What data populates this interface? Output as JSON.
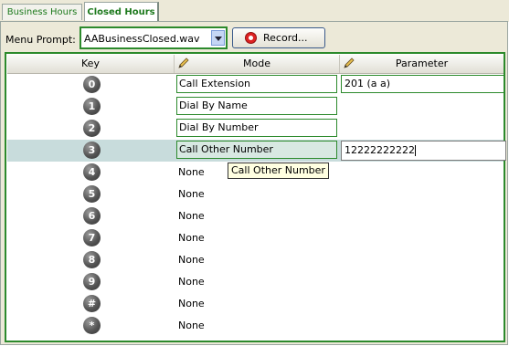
{
  "tabs": [
    {
      "label": "Business Hours"
    },
    {
      "label": "Closed Hours"
    }
  ],
  "prompt": {
    "label": "Menu Prompt:",
    "selected": "AABusinessClosed.wav",
    "record_label": "Record..."
  },
  "grid": {
    "columns": {
      "key": "Key",
      "mode": "Mode",
      "parameter": "Parameter"
    },
    "rows": [
      {
        "key": "0",
        "mode": "Call Extension",
        "parameter": "201 (a a)"
      },
      {
        "key": "1",
        "mode": "Dial By Name",
        "parameter": ""
      },
      {
        "key": "2",
        "mode": "Dial By Number",
        "parameter": ""
      },
      {
        "key": "3",
        "mode": "Call Other Number",
        "parameter": "12222222222"
      },
      {
        "key": "4",
        "mode": "None",
        "parameter": ""
      },
      {
        "key": "5",
        "mode": "None",
        "parameter": ""
      },
      {
        "key": "6",
        "mode": "None",
        "parameter": ""
      },
      {
        "key": "7",
        "mode": "None",
        "parameter": ""
      },
      {
        "key": "8",
        "mode": "None",
        "parameter": ""
      },
      {
        "key": "9",
        "mode": "None",
        "parameter": ""
      },
      {
        "key": "#",
        "mode": "None",
        "parameter": ""
      },
      {
        "key": "*",
        "mode": "None",
        "parameter": ""
      }
    ]
  },
  "tooltip": "Call Other Number",
  "colors": {
    "accent_green": "#2c8a2c",
    "selected_row": "#c8dcdc",
    "tab_text": "#1e7a1e"
  },
  "icons": {
    "column_edit": "pencil-icon",
    "record": "record-icon",
    "dropdown": "chevron-down-icon"
  }
}
